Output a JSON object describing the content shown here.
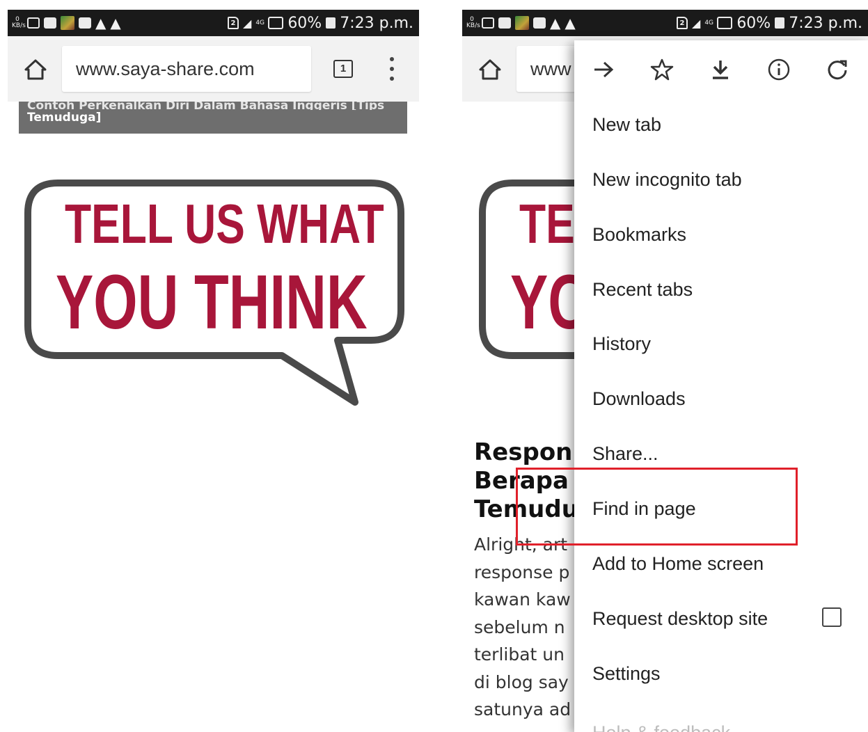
{
  "status_bar": {
    "kbs_value": "0",
    "kbs_unit": "KB/s",
    "sim_slot": "2",
    "network": "4G",
    "battery": "60%",
    "time": "7:23 p.m."
  },
  "browser": {
    "url": "www.saya-share.com",
    "url_clipped": "www",
    "tab_count": "1"
  },
  "page": {
    "banner_line1": "Contoh Perkenalkan Diri Dalam Bahasa Inggeris [Tips",
    "banner_line2": "Temuduga]",
    "bubble_line1": "TELL US WHAT",
    "bubble_line2": "YOU THINK",
    "bubble_clip_line1": "TE",
    "bubble_clip_line2": "YC",
    "article_title_lines": [
      "Respon",
      "Berapa",
      "Temudu"
    ],
    "article_body_lines": [
      "Alright, art",
      "response p",
      "kawan kaw",
      "sebelum n",
      "terlibat un",
      "di blog say",
      "satunya ad"
    ]
  },
  "menu": {
    "icons": [
      "forward-icon",
      "star-icon",
      "download-icon",
      "info-icon",
      "refresh-icon"
    ],
    "items": [
      {
        "label": "New tab"
      },
      {
        "label": "New incognito tab"
      },
      {
        "label": "Bookmarks"
      },
      {
        "label": "Recent tabs"
      },
      {
        "label": "History"
      },
      {
        "label": "Downloads"
      },
      {
        "label": "Share..."
      },
      {
        "label": "Find in page"
      },
      {
        "label": "Add to Home screen"
      },
      {
        "label": "Request desktop site"
      },
      {
        "label": "Settings"
      },
      {
        "label": "Help & feedback"
      }
    ],
    "highlighted_item": "Find in page"
  },
  "colors": {
    "status_bar_bg": "#1a1a1a",
    "toolbar_bg": "#f2f2f2",
    "banner_bg": "#6e6e6e",
    "bubble_text": "#a8163a",
    "bubble_outline": "#4a4a4a",
    "highlight_border": "#e0202a"
  }
}
